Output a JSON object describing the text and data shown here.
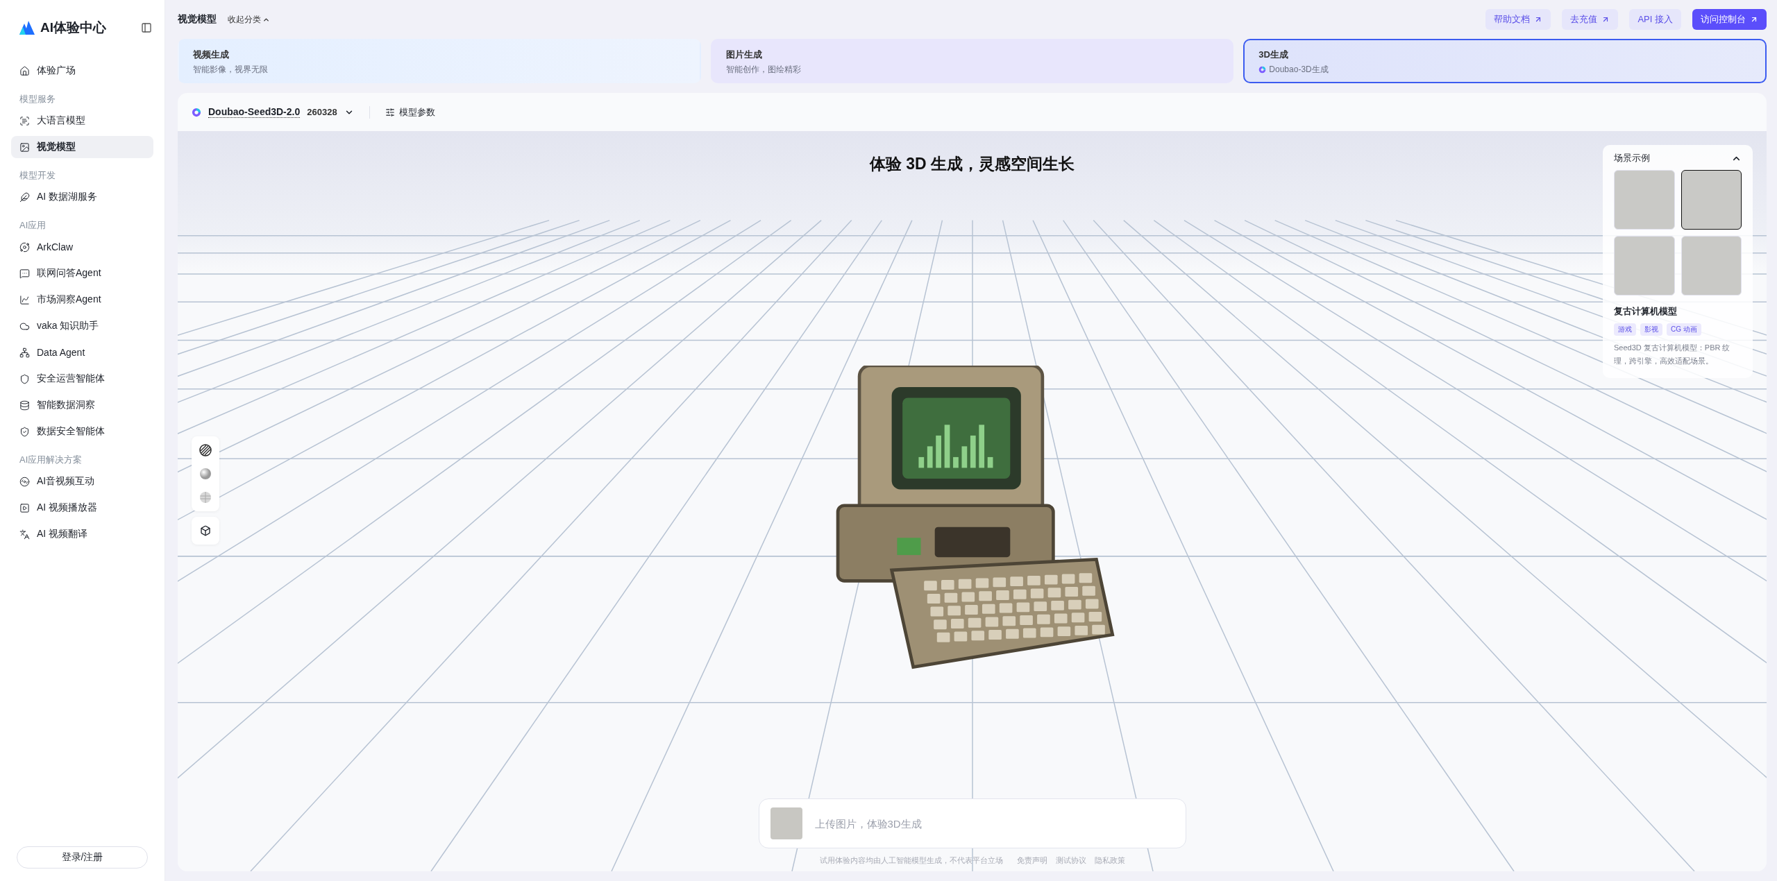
{
  "sidebar": {
    "logo_text": "AI体验中心",
    "sections": [
      {
        "items": [
          {
            "label": "体验广场",
            "selected": false
          }
        ]
      },
      {
        "title": "模型服务",
        "items": [
          {
            "label": "大语言模型",
            "selected": false
          },
          {
            "label": "视觉模型",
            "selected": true
          }
        ]
      },
      {
        "title": "模型开发",
        "items": [
          {
            "label": "AI 数据湖服务",
            "selected": false
          }
        ]
      },
      {
        "title": "AI应用",
        "items": [
          {
            "label": "ArkClaw",
            "selected": false
          },
          {
            "label": "联网问答Agent",
            "selected": false
          },
          {
            "label": "市场洞察Agent",
            "selected": false
          },
          {
            "label": "vaka 知识助手",
            "selected": false
          },
          {
            "label": "Data Agent",
            "selected": false
          },
          {
            "label": "安全运营智能体",
            "selected": false
          },
          {
            "label": "智能数据洞察",
            "selected": false
          },
          {
            "label": "数据安全智能体",
            "selected": false
          }
        ]
      },
      {
        "title": "AI应用解决方案",
        "items": [
          {
            "label": "AI音视频互动",
            "selected": false
          },
          {
            "label": "AI 视频播放器",
            "selected": false
          },
          {
            "label": "AI 视频翻译",
            "selected": false
          }
        ]
      }
    ],
    "login_button": "登录/注册"
  },
  "header": {
    "title": "视觉模型",
    "collapse_label": "收起分类",
    "links": [
      {
        "label": "帮助文档",
        "kind": "secondary",
        "external": true
      },
      {
        "label": "去充值",
        "kind": "secondary",
        "external": true
      },
      {
        "label": "API 接入",
        "kind": "secondary",
        "external": false
      },
      {
        "label": "访问控制台",
        "kind": "primary",
        "external": true
      }
    ]
  },
  "categories": [
    {
      "title": "视频生成",
      "subtitle": "智能影像，视界无限",
      "selected": false
    },
    {
      "title": "图片生成",
      "subtitle": "智能创作，图绘精彩",
      "selected": false
    },
    {
      "title": "3D生成",
      "subtitle": "Doubao-3D生成",
      "selected": true
    }
  ],
  "model_bar": {
    "model": "Doubao-Seed3D-2.0",
    "version": "260328",
    "params_label": "模型参数"
  },
  "canvas": {
    "headline": "体验 3D 生成，灵感空间生长",
    "scene_panel": {
      "title": "场景示例",
      "expanded": true,
      "thumbnails": [
        {
          "selected": false
        },
        {
          "selected": true
        },
        {
          "selected": false
        },
        {
          "selected": false
        }
      ],
      "name": "复古计算机模型",
      "tags": [
        "游戏",
        "影视",
        "CG 动画"
      ],
      "description": "Seed3D 复古计算机模型：PBR 纹理，跨引擎，高效适配场景。"
    },
    "input": {
      "placeholder": "上传图片，体验3D生成"
    },
    "footer": {
      "disclaimer": "试用体验内容均由人工智能模型生成，不代表平台立场",
      "links": [
        "免责声明",
        "测试协议",
        "隐私政策"
      ]
    }
  }
}
